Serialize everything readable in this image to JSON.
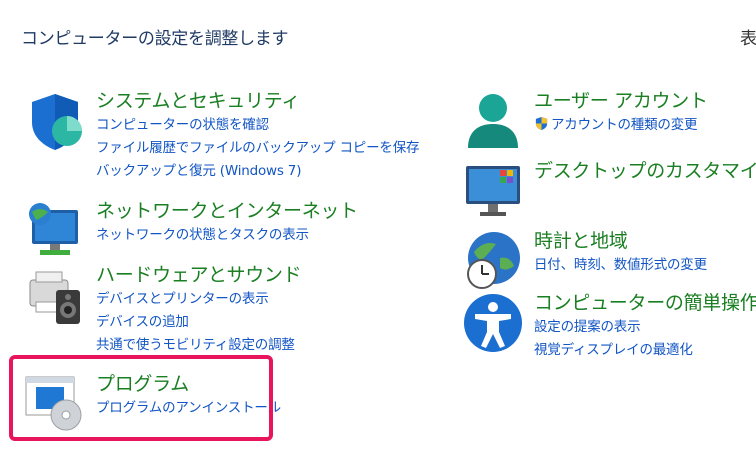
{
  "header": {
    "title": "コンピューターの設定を調整します",
    "view_by": "表"
  },
  "left": [
    {
      "title": "システムとセキュリティ",
      "icon": "shield-icon",
      "links": [
        "コンピューターの状態を確認",
        "ファイル履歴でファイルのバックアップ コピーを保存",
        "バックアップと復元 (Windows 7)"
      ]
    },
    {
      "title": "ネットワークとインターネット",
      "icon": "network-globe-icon",
      "links": [
        "ネットワークの状態とタスクの表示"
      ]
    },
    {
      "title": "ハードウェアとサウンド",
      "icon": "printer-speaker-icon",
      "links": [
        "デバイスとプリンターの表示",
        "デバイスの追加",
        "共通で使うモビリティ設定の調整"
      ]
    },
    {
      "title": "プログラム",
      "icon": "programs-disc-icon",
      "links": [
        "プログラムのアンインストール"
      ]
    }
  ],
  "right": [
    {
      "title": "ユーザー アカウント",
      "icon": "user-icon",
      "links": [
        "アカウントの種類の変更"
      ]
    },
    {
      "title": "デスクトップのカスタマイズ",
      "icon": "desktop-monitor-icon",
      "links": []
    },
    {
      "title": "時計と地域",
      "icon": "clock-globe-icon",
      "links": [
        "日付、時刻、数値形式の変更"
      ]
    },
    {
      "title": "コンピューターの簡単操作",
      "icon": "accessibility-icon",
      "links": [
        "設定の提案の表示",
        "視覚ディスプレイの最適化"
      ]
    }
  ],
  "colors": {
    "title_green": "#1a7f22",
    "link_blue": "#1255c4",
    "highlight": "#e8155c"
  }
}
